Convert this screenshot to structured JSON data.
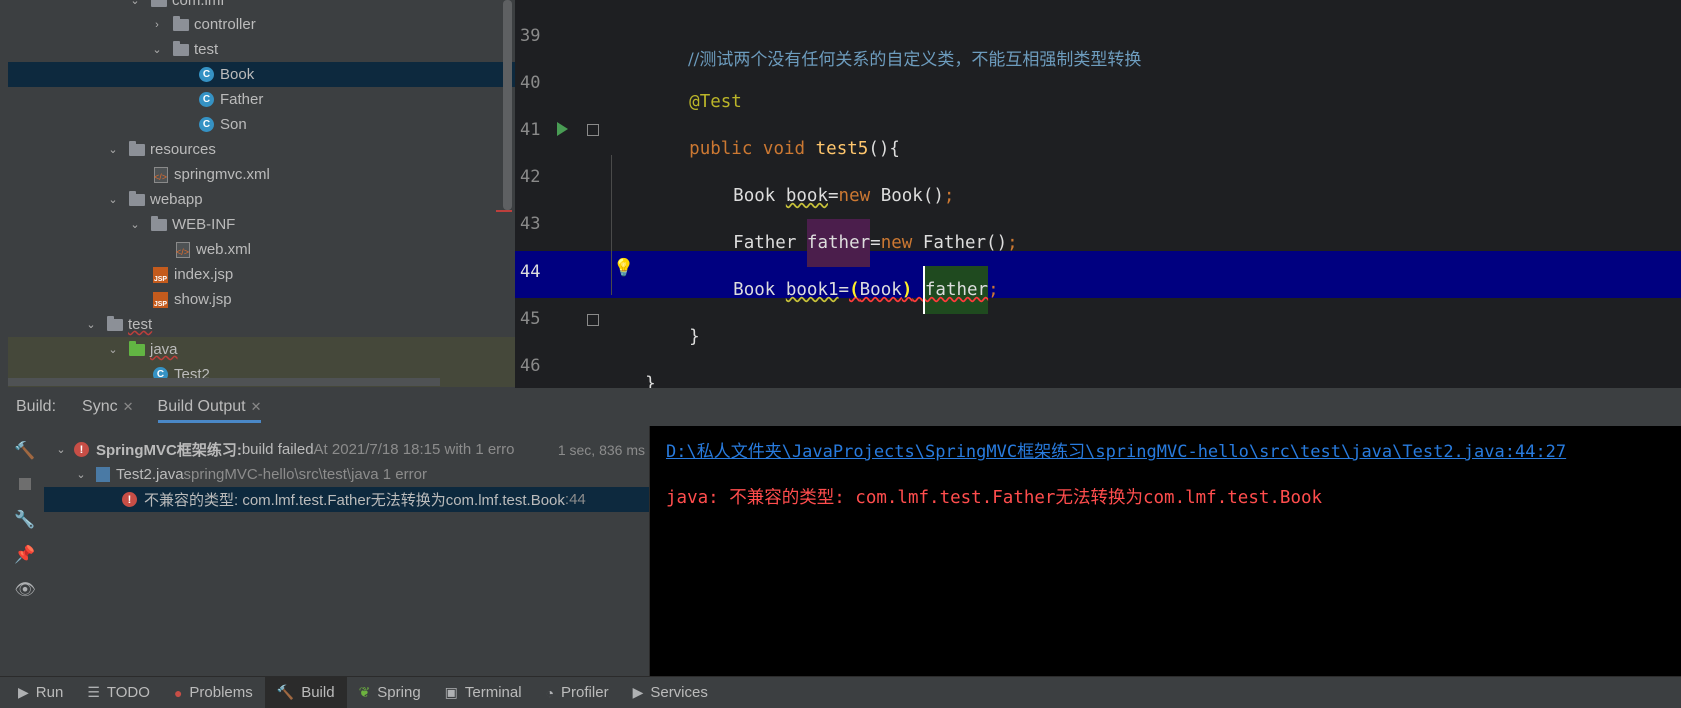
{
  "project_tree": {
    "rows": [
      {
        "label": "com.lmf",
        "icon": "package-icon",
        "arrow": "down"
      },
      {
        "label": "controller",
        "icon": "package-icon",
        "arrow": "right"
      },
      {
        "label": "test",
        "icon": "package-icon",
        "arrow": "down"
      },
      {
        "label": "Book",
        "icon": "class-icon"
      },
      {
        "label": "Father",
        "icon": "class-icon"
      },
      {
        "label": "Son",
        "icon": "class-icon"
      },
      {
        "label": "resources",
        "icon": "resources-folder-icon",
        "arrow": "down"
      },
      {
        "label": "springmvc.xml",
        "icon": "xml-file-icon"
      },
      {
        "label": "webapp",
        "icon": "web-folder-icon",
        "arrow": "down"
      },
      {
        "label": "WEB-INF",
        "icon": "folder-icon",
        "arrow": "down"
      },
      {
        "label": "web.xml",
        "icon": "xml-file-icon"
      },
      {
        "label": "index.jsp",
        "icon": "jsp-file-icon"
      },
      {
        "label": "show.jsp",
        "icon": "jsp-file-icon"
      },
      {
        "label": "test",
        "icon": "folder-icon",
        "arrow": "down"
      },
      {
        "label": "java",
        "icon": "test-source-folder-icon",
        "arrow": "down"
      },
      {
        "label": "Test2",
        "icon": "test-class-icon"
      }
    ]
  },
  "editor": {
    "line_numbers": [
      "39",
      "40",
      "41",
      "42",
      "43",
      "44",
      "45",
      "46"
    ],
    "comment": "//测试两个没有任何关系的自定义类，不能互相强制类型转换",
    "annotation": "@Test",
    "kw_public": "public",
    "kw_void": "void",
    "method_name": "test5",
    "method_tail": "(){",
    "line42": {
      "type": "Book ",
      "var": "book",
      "eq": "=",
      "kw_new": "new",
      "ctor": " Book()",
      "semi": ";"
    },
    "line43": {
      "type": "Father ",
      "var": "father",
      "eq": "=",
      "kw_new": "new",
      "ctor": " Father()",
      "semi": ";"
    },
    "line44": {
      "type": "Book ",
      "var": "book1",
      "eq": "=",
      "cast_open": "(",
      "cast_type": "Book",
      "cast_close": ")",
      "space": " ",
      "var2": "father",
      "semi": ";"
    },
    "close_method": "}",
    "close_class": "}"
  },
  "build": {
    "label": "Build:",
    "tabs": [
      {
        "label": "Sync",
        "active": false
      },
      {
        "label": "Build Output",
        "active": true
      }
    ],
    "tree": {
      "root_title": "SpringMVC框架练习:",
      "root_status": " build failed",
      "root_detail": " At 2021/7/18 18:15 with 1 erro",
      "root_time": "1 sec, 836 ms",
      "file_name": "Test2.java",
      "file_detail": " springMVC-hello\\src\\test\\java 1 error",
      "error_text": "不兼容的类型: com.lmf.test.Father无法转换为com.lmf.test.Book",
      "error_line": " :44"
    },
    "console": {
      "path": "D:\\私人文件夹\\JavaProjects\\SpringMVC框架练习\\springMVC-hello\\src\\test\\java\\Test2.java:44:27",
      "message": "java: 不兼容的类型: com.lmf.test.Father无法转换为com.lmf.test.Book"
    }
  },
  "statusbar": {
    "items": [
      {
        "label": "Run",
        "icon": "run-icon"
      },
      {
        "label": "TODO",
        "icon": "todo-icon"
      },
      {
        "label": "Problems",
        "icon": "problems-icon"
      },
      {
        "label": "Build",
        "icon": "build-icon",
        "active": true
      },
      {
        "label": "Spring",
        "icon": "spring-icon"
      },
      {
        "label": "Terminal",
        "icon": "terminal-icon"
      },
      {
        "label": "Profiler",
        "icon": "profiler-icon"
      },
      {
        "label": "Services",
        "icon": "services-icon"
      }
    ]
  },
  "colors": {
    "editor_bg": "#1e1f22",
    "current_line": "#000080",
    "keyword": "#cc7832",
    "method": "#ffc66d",
    "annotation": "#bbb529",
    "comment": "#6d9cbe",
    "error": "#ff4d4d",
    "link": "#287bde"
  }
}
